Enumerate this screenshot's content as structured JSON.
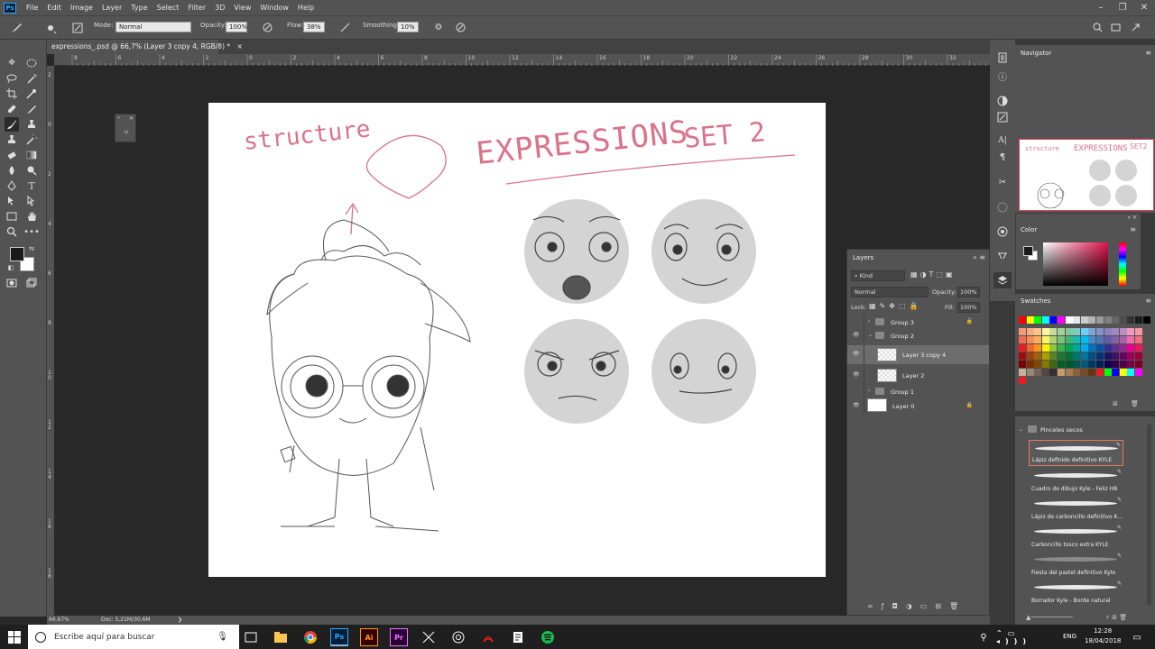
{
  "menubar": {
    "items": [
      "File",
      "Edit",
      "Image",
      "Layer",
      "Type",
      "Select",
      "Filter",
      "3D",
      "View",
      "Window",
      "Help"
    ]
  },
  "options": {
    "mode_label": "Mode:",
    "mode_value": "Normal",
    "opacity_label": "Opacity:",
    "opacity_value": "100%",
    "flow_label": "Flow:",
    "flow_value": "38%",
    "smoothing_label": "Smoothing:",
    "smoothing_value": "10%"
  },
  "document": {
    "tab_title": "expressions_.psd @ 66,7% (Layer 3 copy 4, RGB/8) *",
    "close": "×"
  },
  "ruler": {
    "h_ticks": [
      "8",
      "6",
      "4",
      "2",
      "0",
      "2",
      "4",
      "6",
      "8",
      "10",
      "12",
      "14",
      "16",
      "18",
      "20",
      "22",
      "24",
      "26",
      "28",
      "30",
      "32"
    ],
    "v_ticks": [
      "2",
      "0",
      "2",
      "4",
      "6",
      "8",
      "10",
      "12",
      "14",
      "16",
      "18"
    ]
  },
  "status": {
    "zoom": "66.67%",
    "doc": "Doc: 5,21M/30,6M",
    "arrow": "❯"
  },
  "artwork": {
    "structure": "structure",
    "title_main": "EXPRESSIONS",
    "title_set": "SET 2"
  },
  "navigator": {
    "title": "Navigator"
  },
  "color": {
    "title": "Color",
    "fg": "#1a1a1a",
    "bg": "#ffffff"
  },
  "swatches": {
    "title": "Swatches",
    "row1": [
      "#ff0000",
      "#ffff00",
      "#00ff00",
      "#00ffff",
      "#0000ff",
      "#ff00ff",
      "#ffffff",
      "#e6e6e6",
      "#cccccc",
      "#b3b3b3",
      "#999999",
      "#808080",
      "#666666",
      "#4d4d4d",
      "#333333",
      "#1a1a1a",
      "#000000"
    ],
    "rows": [
      [
        "#f7977a",
        "#f9ad81",
        "#fdc68a",
        "#fff79a",
        "#c4df9b",
        "#a2d39c",
        "#82ca9d",
        "#7bcdc8",
        "#6ecff6",
        "#7ea7d8",
        "#8493ca",
        "#8882be",
        "#a187be",
        "#bc8dbf",
        "#f49ac2",
        "#f6989d"
      ],
      [
        "#f26c4f",
        "#f68e55",
        "#fbaf5c",
        "#fff467",
        "#acd372",
        "#7cc576",
        "#3bb878",
        "#1abbb4",
        "#00bff3",
        "#438ccb",
        "#5574b9",
        "#605ca8",
        "#855fa8",
        "#a763a8",
        "#f06ea9",
        "#f26d7d"
      ],
      [
        "#ed1c24",
        "#f26522",
        "#f7941d",
        "#fff200",
        "#8dc73f",
        "#39b54a",
        "#00a651",
        "#00a99d",
        "#00aeef",
        "#0072bc",
        "#0054a6",
        "#2e3192",
        "#662d91",
        "#92278f",
        "#ec008c",
        "#ed145b"
      ],
      [
        "#9e0b0f",
        "#a0410d",
        "#a36209",
        "#aba000",
        "#598527",
        "#1a7b30",
        "#007236",
        "#00746b",
        "#0076a3",
        "#004b80",
        "#003471",
        "#1b1464",
        "#440e62",
        "#630460",
        "#9e005d",
        "#9e0039"
      ],
      [
        "#790000",
        "#7b2e00",
        "#7d4900",
        "#827b00",
        "#406618",
        "#005e20",
        "#005826",
        "#005952",
        "#005b7f",
        "#003663",
        "#002157",
        "#0d004c",
        "#32004b",
        "#4b0049",
        "#7b0046",
        "#7a0026"
      ],
      [
        "#c7b299",
        "#998675",
        "#736357",
        "#534741",
        "#37302d",
        "#c69c6d",
        "#a67c52",
        "#8c6239",
        "#754c24",
        "#603913",
        "#ed1c24",
        "#00ff00",
        "#0000ff",
        "#ffff00",
        "#00ffff",
        "#ff00ff"
      ]
    ]
  },
  "layers": {
    "title": "Layers",
    "kind": "Kind",
    "blend": "Normal",
    "opacity_label": "Opacity:",
    "opacity_value": "100%",
    "lock_label": "Lock:",
    "fill_label": "Fill:",
    "fill_value": "100%",
    "rows": [
      {
        "name": "Group 3",
        "type": "group",
        "visible": false,
        "locked": true,
        "indent": 0
      },
      {
        "name": "Group 2",
        "type": "group-open",
        "visible": true,
        "locked": false,
        "indent": 0
      },
      {
        "name": "Layer 3 copy 4",
        "type": "layer",
        "visible": true,
        "locked": false,
        "indent": 1,
        "selected": true
      },
      {
        "name": "Layer 2",
        "type": "layer",
        "visible": true,
        "locked": false,
        "indent": 1
      },
      {
        "name": "Group 1",
        "type": "group",
        "visible": false,
        "locked": false,
        "indent": 0
      },
      {
        "name": "Layer 0",
        "type": "layer",
        "visible": true,
        "locked": true,
        "indent": 0,
        "white": true
      }
    ]
  },
  "brushes": {
    "group": "Pinceles secos",
    "items": [
      "Lápiz definido definitivo KYLE",
      "Cuadro de dibujo Kyle - Feliz HB",
      "Lápiz de carboncillo definitivo K...",
      "Carboncillo tosco extra KYLE",
      "Fiesta del pastel definitivo Kyle",
      "Borrador Kyle - Borde natural"
    ]
  },
  "taskbar": {
    "search_placeholder": "Escribe aquí para buscar",
    "lang": "ENG",
    "time": "12:28",
    "date": "18/04/2018"
  }
}
